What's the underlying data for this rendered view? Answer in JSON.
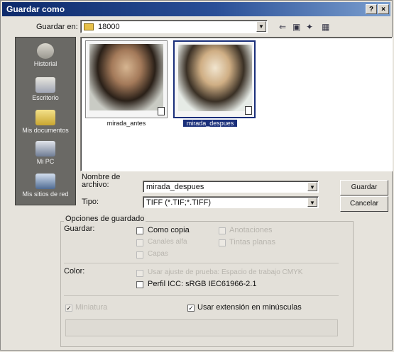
{
  "window": {
    "title": "Guardar como",
    "help_label": "?",
    "close_label": "×"
  },
  "toolbar": {
    "save_in_label": "Guardar en:",
    "save_in_value": "18000",
    "back_glyph": "⇐",
    "up_glyph": "▣",
    "new_folder_glyph": "✦",
    "view_glyph": "▦"
  },
  "sidebar": {
    "items": [
      {
        "label": "Historial",
        "icon": "history-icon"
      },
      {
        "label": "Escritorio",
        "icon": "desktop-icon"
      },
      {
        "label": "Mis documentos",
        "icon": "my-documents-icon"
      },
      {
        "label": "Mi PC",
        "icon": "my-computer-icon"
      },
      {
        "label": "Mis sitios de red",
        "icon": "network-places-icon"
      }
    ]
  },
  "files": [
    {
      "name": "mirada_antes",
      "selected": false
    },
    {
      "name": "mirada_despues",
      "selected": true
    }
  ],
  "form": {
    "filename_label": "Nombre de archivo:",
    "filename_value": "mirada_despues",
    "type_label": "Tipo:",
    "type_value": "TIFF (*.TIF;*.TIFF)",
    "save_button": "Guardar",
    "cancel_button": "Cancelar"
  },
  "options": {
    "title": "Opciones de guardado",
    "save_label": "Guardar:",
    "as_copy": "Como copia",
    "annotations": "Anotaciones",
    "alpha_channels": "Canales alfa",
    "spot_colors": "Tintas planas",
    "layers": "Capas",
    "color_label": "Color:",
    "use_proof": "Usar ajuste de prueba: Espacio de trabajo CMYK",
    "icc_profile": "Perfil ICC: sRGB IEC61966-2.1",
    "thumbnail": "Miniatura",
    "lowercase_ext": "Usar extensión en minúsculas"
  },
  "state": {
    "as_copy_checked": false,
    "icc_checked": false,
    "thumbnail_checked": true,
    "lowercase_checked": true
  }
}
